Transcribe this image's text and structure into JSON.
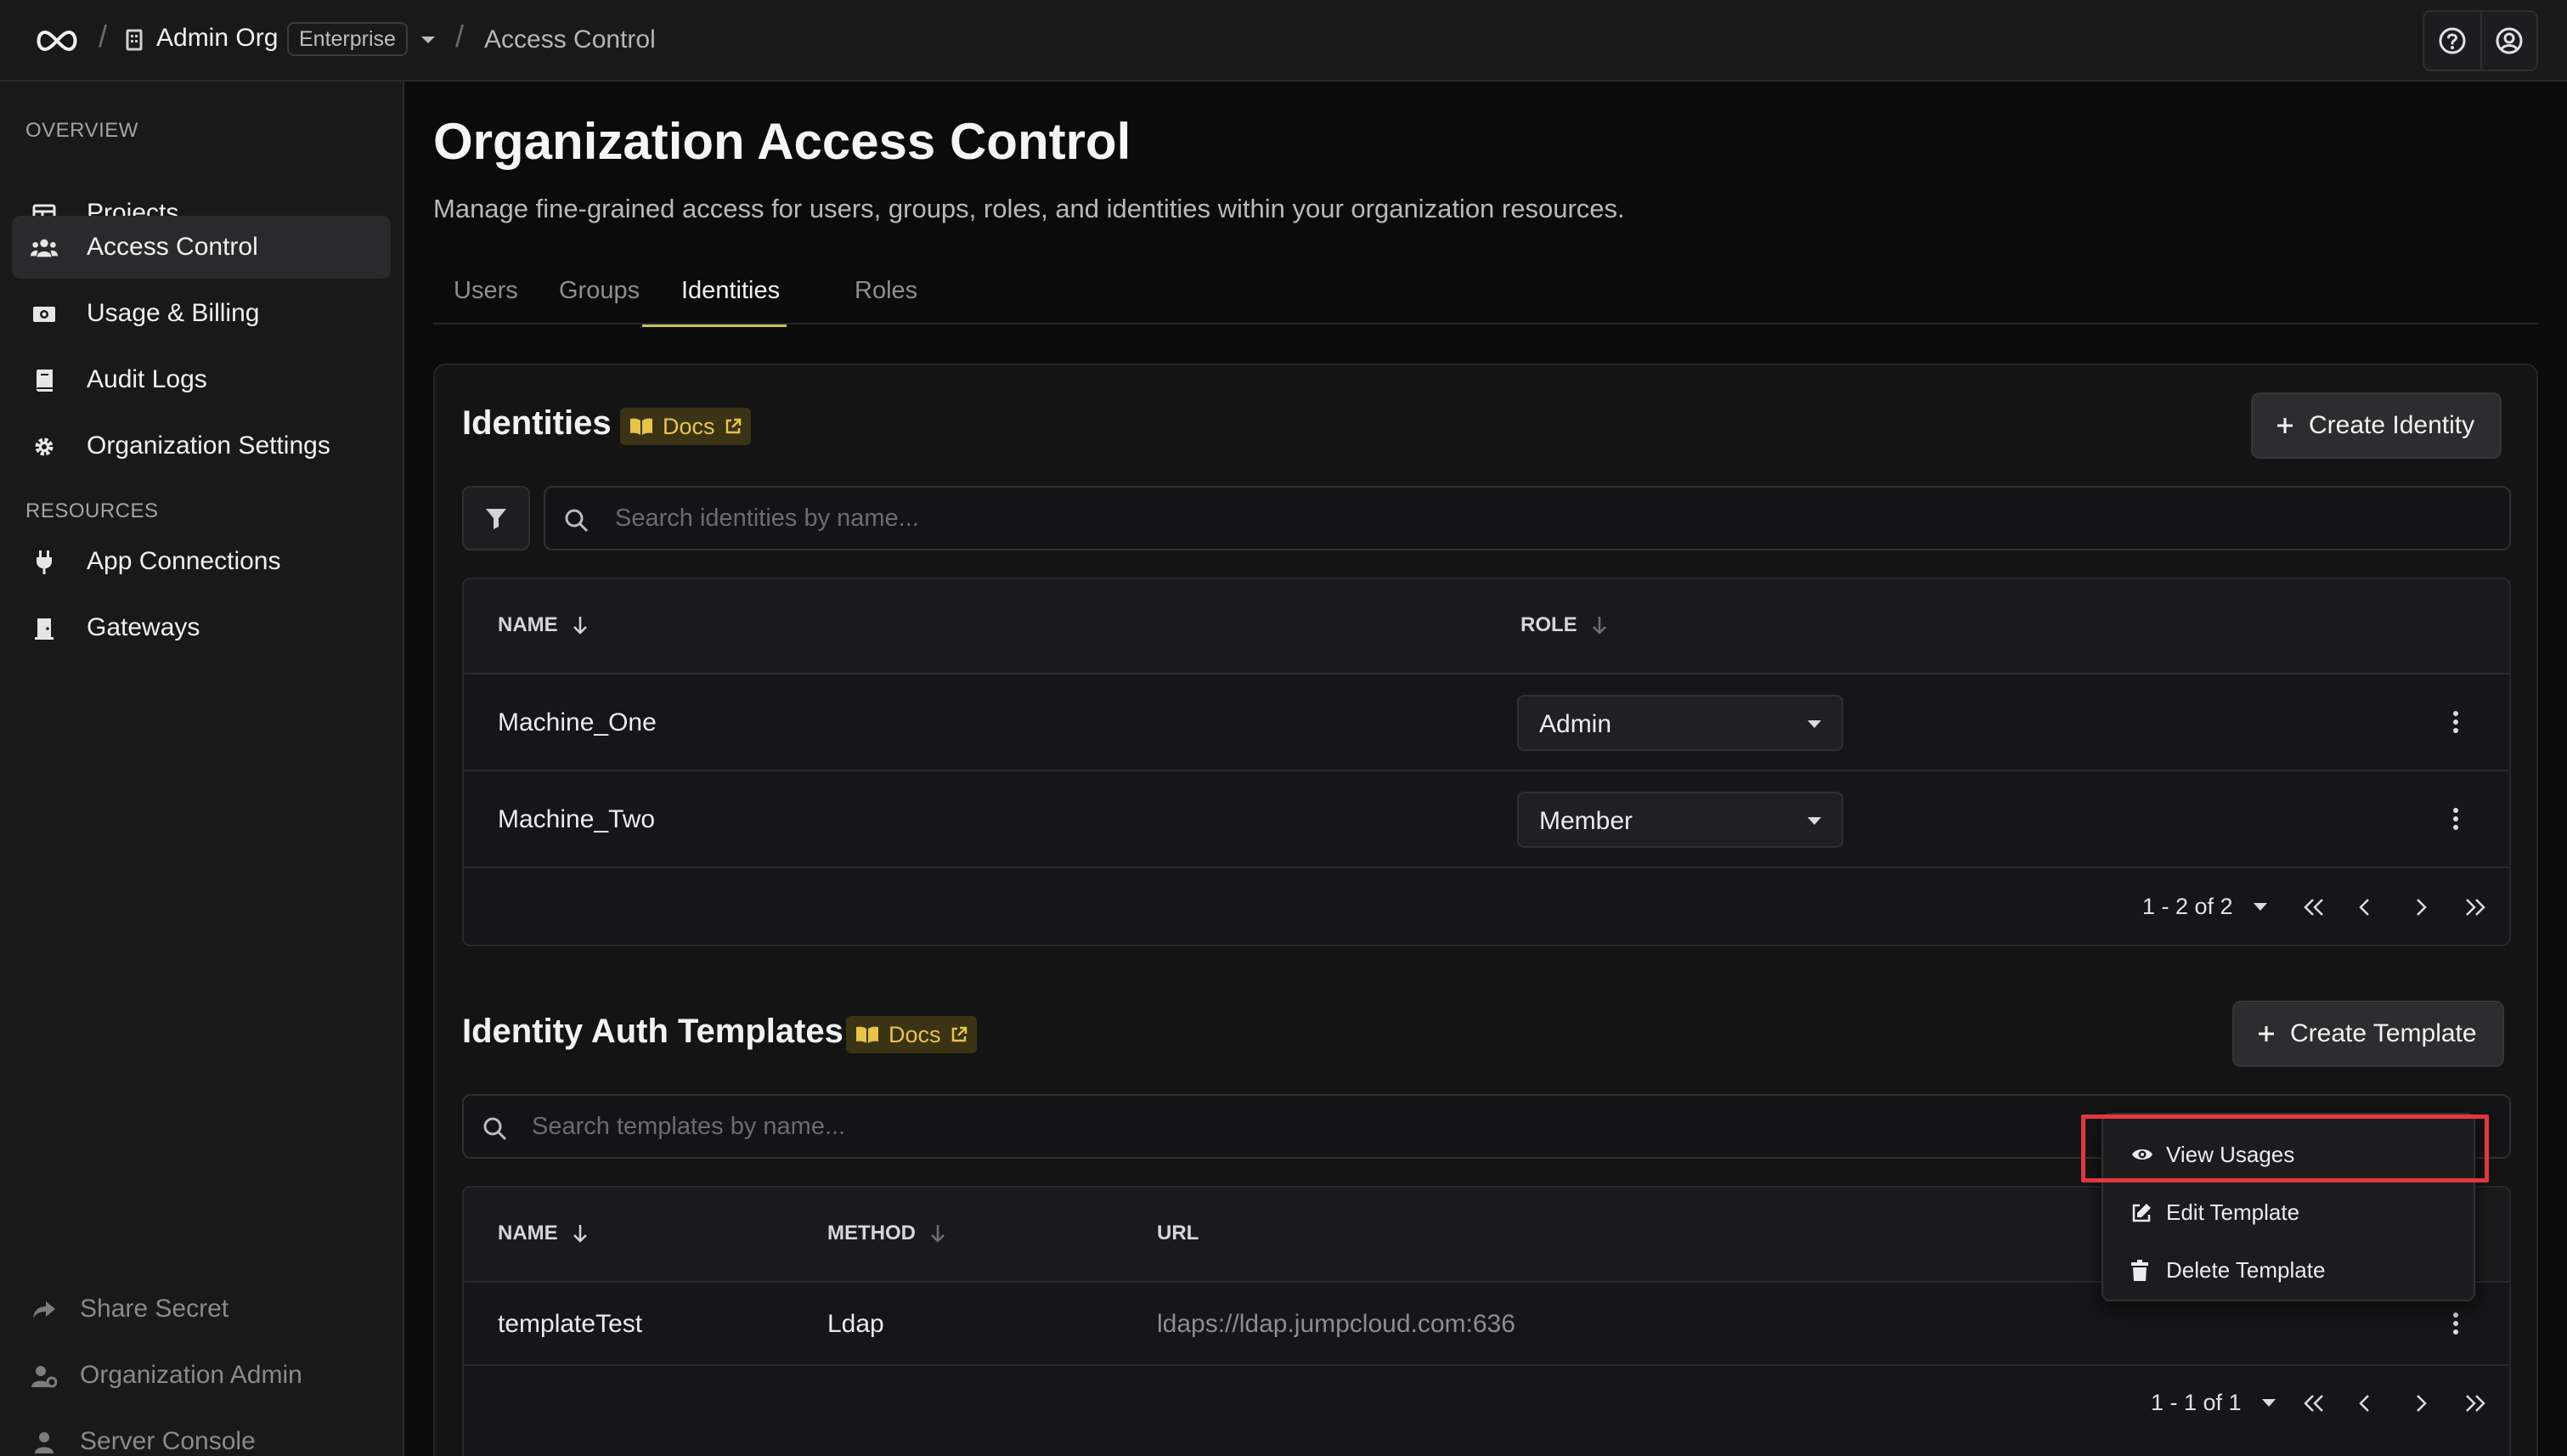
{
  "header": {
    "org_name": "Admin Org",
    "plan": "Enterprise",
    "separator": "/",
    "current_page": "Access Control"
  },
  "sidebar": {
    "sections": [
      {
        "label": "OVERVIEW"
      },
      {
        "label": "RESOURCES"
      }
    ],
    "overview_items": [
      {
        "label": "Projects",
        "icon": "table-icon"
      },
      {
        "label": "Access Control",
        "icon": "users-icon",
        "active": true
      },
      {
        "label": "Usage & Billing",
        "icon": "money-icon"
      },
      {
        "label": "Audit Logs",
        "icon": "book-icon"
      },
      {
        "label": "Organization Settings",
        "icon": "gear-icon"
      }
    ],
    "resource_items": [
      {
        "label": "App Connections",
        "icon": "plug-icon"
      },
      {
        "label": "Gateways",
        "icon": "door-icon"
      }
    ],
    "footer_items": [
      {
        "label": "Share Secret",
        "icon": "share-icon"
      },
      {
        "label": "Organization Admin",
        "icon": "user-gear-icon"
      },
      {
        "label": "Server Console",
        "icon": "user-icon"
      }
    ]
  },
  "page": {
    "title": "Organization Access Control",
    "description": "Manage fine-grained access for users, groups, roles, and identities within your organization resources.",
    "tabs": [
      {
        "label": "Users"
      },
      {
        "label": "Groups"
      },
      {
        "label": "Identities",
        "active": true
      },
      {
        "label": "Roles"
      }
    ]
  },
  "identities": {
    "title": "Identities",
    "docs_label": "Docs",
    "create_label": "Create Identity",
    "search_placeholder": "Search identities by name...",
    "columns": {
      "name": "NAME",
      "role": "ROLE"
    },
    "rows": [
      {
        "name": "Machine_One",
        "role": "Admin"
      },
      {
        "name": "Machine_Two",
        "role": "Member"
      }
    ],
    "pagination": "1 - 2 of 2"
  },
  "templates": {
    "title": "Identity Auth Templates",
    "docs_label": "Docs",
    "create_label": "Create Template",
    "search_placeholder": "Search templates by name...",
    "columns": {
      "name": "NAME",
      "method": "METHOD",
      "url": "URL"
    },
    "rows": [
      {
        "name": "templateTest",
        "method": "Ldap",
        "url": "ldaps://ldap.jumpcloud.com:636"
      }
    ],
    "pagination": "1 - 1 of 1"
  },
  "context_menu": {
    "items": [
      {
        "label": "View Usages",
        "icon": "eye-icon"
      },
      {
        "label": "Edit Template",
        "icon": "edit-icon"
      },
      {
        "label": "Delete Template",
        "icon": "trash-icon"
      }
    ]
  },
  "colors": {
    "accent": "#c8c25a",
    "docs_badge_text": "#e8c448",
    "highlight": "#e0383f"
  }
}
